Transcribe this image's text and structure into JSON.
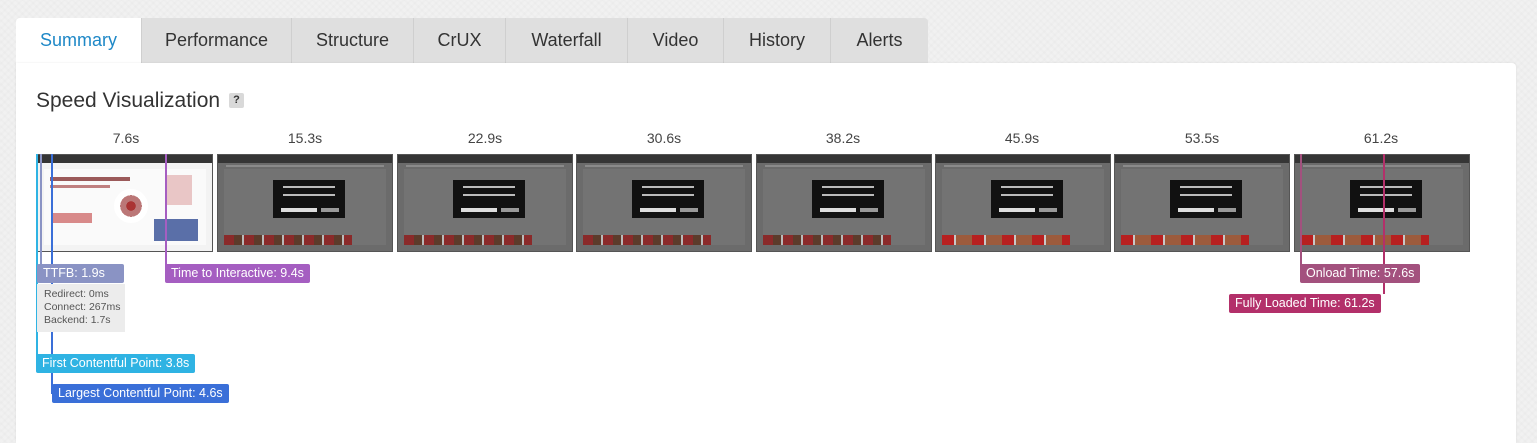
{
  "tabs": [
    {
      "label": "Summary",
      "active": true
    },
    {
      "label": "Performance"
    },
    {
      "label": "Structure"
    },
    {
      "label": "CrUX"
    },
    {
      "label": "Waterfall"
    },
    {
      "label": "Video"
    },
    {
      "label": "History"
    },
    {
      "label": "Alerts"
    }
  ],
  "section": {
    "title": "Speed Visualization",
    "help_icon": "?"
  },
  "filmstrip": {
    "times": [
      "7.6s",
      "15.3s",
      "22.9s",
      "30.6s",
      "38.2s",
      "45.9s",
      "53.5s",
      "61.2s"
    ]
  },
  "markers": {
    "ttfb": "TTFB: 1.9s",
    "tti": "Time to Interactive: 9.4s",
    "onload": "Onload Time: 57.6s",
    "fully_loaded": "Fully Loaded Time: 61.2s",
    "fcp": "First Contentful Point: 3.8s",
    "lcp": "Largest Contentful Point: 4.6s"
  },
  "ttfb_details": {
    "redirect": "Redirect: 0ms",
    "connect": "Connect: 267ms",
    "backend": "Backend: 1.7s"
  },
  "colors": {
    "accent": "#1e88c7",
    "ttfb": "#8a93c4",
    "tti": "#a55ec1",
    "onload": "#a3517e",
    "fully_loaded": "#b3306a",
    "fcp": "#2fb3e3",
    "lcp": "#3a6fd8"
  }
}
